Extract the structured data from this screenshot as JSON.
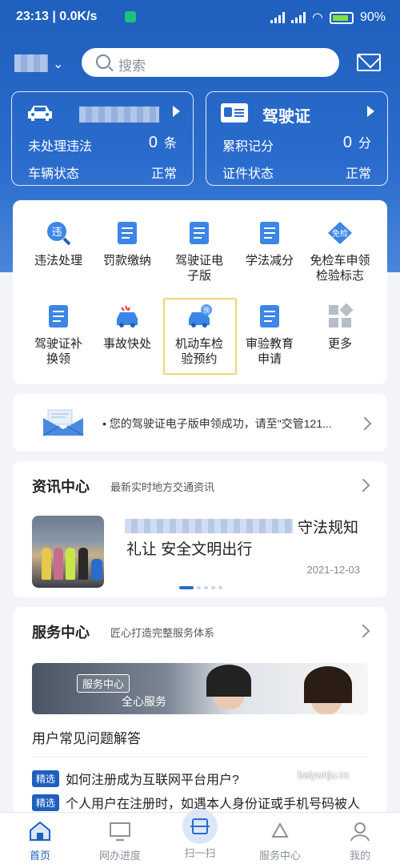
{
  "status_bar": {
    "time": "23:13",
    "speed": "0.0K/s",
    "battery": "90%"
  },
  "search": {
    "placeholder": "搜索"
  },
  "vehicle_card": {
    "violations_label": "未处理违法",
    "violations_count": "0",
    "violations_unit": "条",
    "status_label": "车辆状态",
    "status_value": "正常"
  },
  "license_card": {
    "title": "驾驶证",
    "points_label": "累积记分",
    "points_value": "0",
    "points_unit": "分",
    "status_label": "证件状态",
    "status_value": "正常"
  },
  "services": [
    {
      "label": "违法处理",
      "icon": "violation-icon"
    },
    {
      "label": "罚款缴纳",
      "icon": "fine-payment-icon"
    },
    {
      "label": "驾驶证电子版",
      "icon": "e-license-icon"
    },
    {
      "label": "学法减分",
      "icon": "study-book-icon"
    },
    {
      "label": "免检车申领检验标志",
      "icon": "exempt-inspection-icon"
    },
    {
      "label": "驾驶证补换领",
      "icon": "license-replace-icon"
    },
    {
      "label": "事故快处",
      "icon": "accident-car-icon"
    },
    {
      "label": "机动车检验预约",
      "icon": "inspection-booking-icon"
    },
    {
      "label": "审验教育申请",
      "icon": "document-icon"
    },
    {
      "label": "更多",
      "icon": "more-grid-icon"
    }
  ],
  "service_lines": [
    [
      "违法处理"
    ],
    [
      "罚款缴纳"
    ],
    [
      "驾驶证电",
      "子版"
    ],
    [
      "学法减分"
    ],
    [
      "免检车申领",
      "检验标志"
    ],
    [
      "驾驶证补",
      "换领"
    ],
    [
      "事故快处"
    ],
    [
      "机动车检",
      "验预约"
    ],
    [
      "审验教育",
      "申请"
    ],
    [
      "更多"
    ]
  ],
  "notice": {
    "text": "您的驾驶证电子版申领成功，请至\"交管121..."
  },
  "news": {
    "title": "资讯中心",
    "subtitle": "最新实时地方交通资讯",
    "headline_tail": "守法规知",
    "headline_line2": "礼让 安全文明出行",
    "date": "2021-12-03"
  },
  "service_center": {
    "title": "服务中心",
    "subtitle": "匠心打造完整服务体系",
    "banner_tag": "服务中心",
    "banner_caption": "全心服务",
    "faq_title": "用户常见问题解答",
    "faq_badge": "精选",
    "faq_items": [
      "如何注册成为互联网平台用户?",
      "个人用户在注册时，如遇本人身份证或手机号码被人"
    ]
  },
  "tabbar": {
    "items": [
      {
        "label": "首页",
        "icon": "home-icon"
      },
      {
        "label": "网办进度",
        "icon": "progress-monitor-icon"
      },
      {
        "label": "扫一扫",
        "icon": "scan-icon"
      },
      {
        "label": "服务中心",
        "icon": "service-center-icon"
      },
      {
        "label": "我的",
        "icon": "profile-icon"
      }
    ]
  },
  "watermark": {
    "text": "baiyunju.cc"
  },
  "colors": {
    "primary": "#1f5fbd",
    "highlight_border": "#f2d76b"
  }
}
